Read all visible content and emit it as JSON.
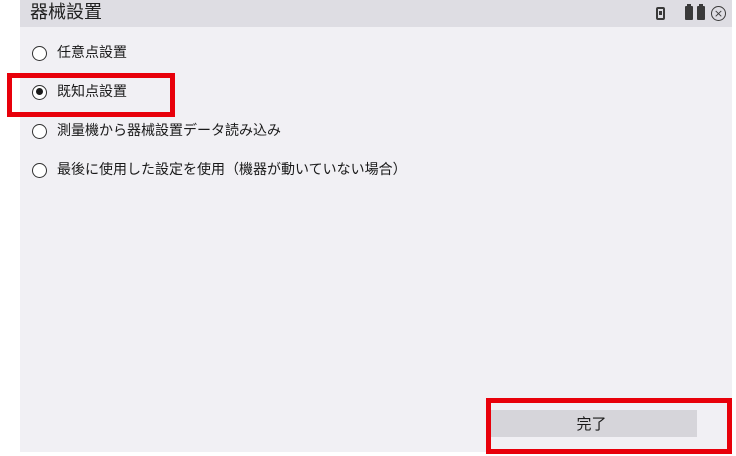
{
  "window": {
    "title": "器械設置",
    "status_icons": [
      "memory-card-icon",
      "battery-icon",
      "battery-icon",
      "close-icon"
    ],
    "close_glyph": "×"
  },
  "options": [
    {
      "label": "任意点設置",
      "checked": false
    },
    {
      "label": "既知点設置",
      "checked": true
    },
    {
      "label": "測量機から器械設置データ読み込み",
      "checked": false
    },
    {
      "label": "最後に使用した設定を使用（機器が動いていない場合）",
      "checked": false
    }
  ],
  "footer": {
    "done_label": "完了"
  },
  "colors": {
    "highlight": "#e8000a",
    "panel_background": "#f1f0f4",
    "titlebar_background": "#dedde3",
    "button_background": "#d6d5da"
  }
}
